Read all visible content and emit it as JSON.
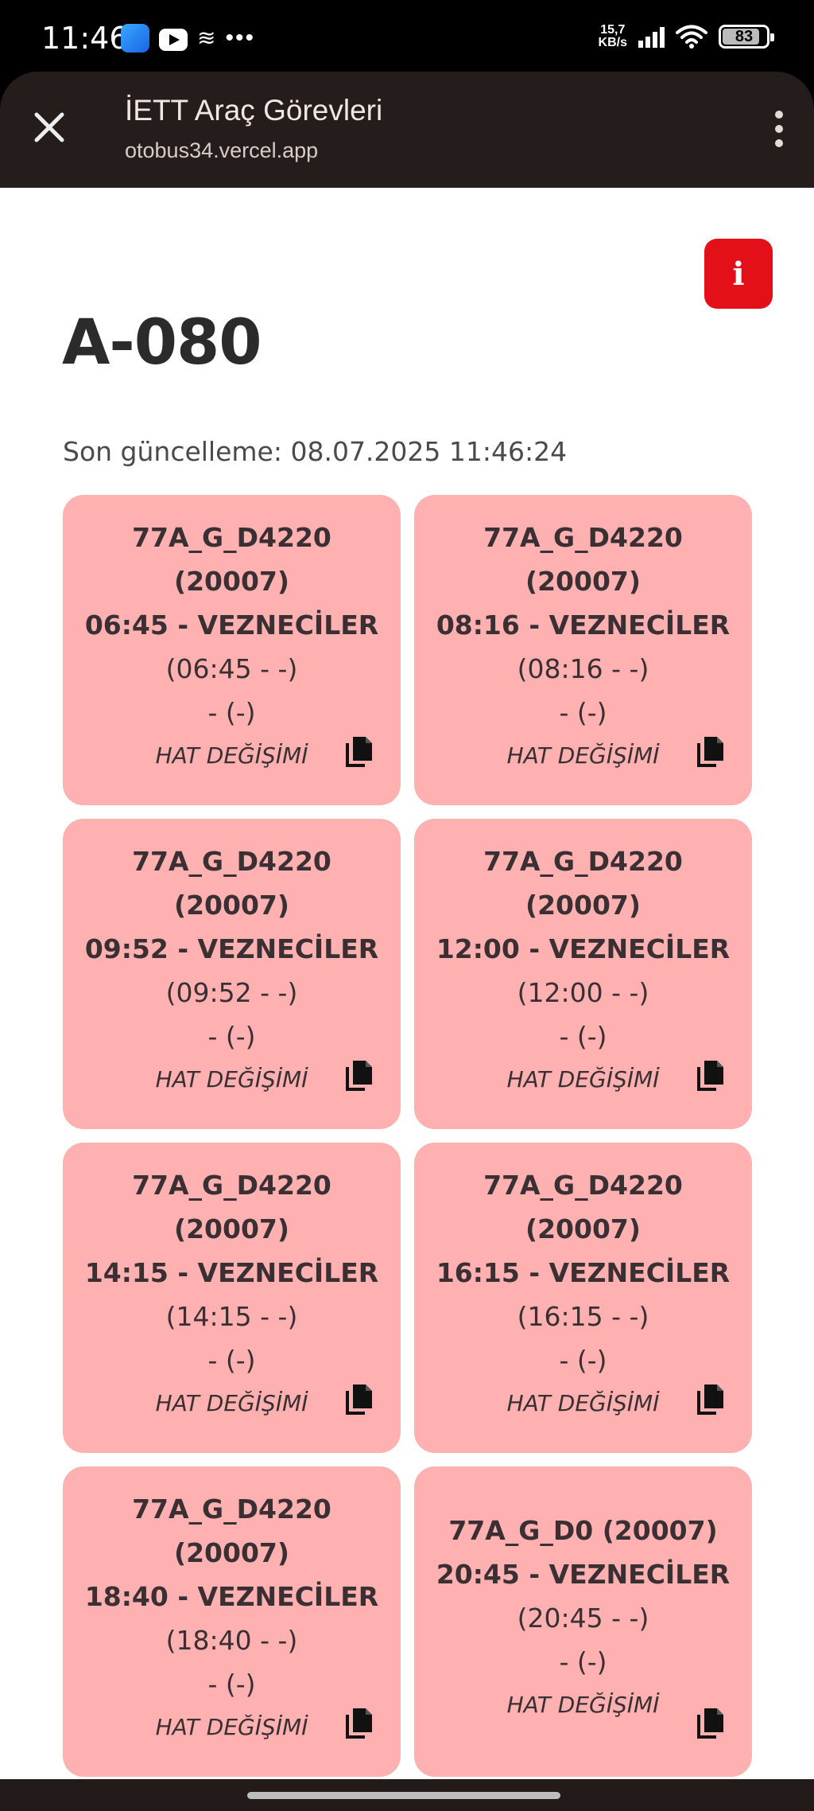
{
  "status_bar": {
    "time": "11:46",
    "net_speed_value": "15,7",
    "net_speed_unit": "KB/s",
    "battery": "83"
  },
  "toolbar": {
    "title": "İETT Araç Görevleri",
    "url": "otobus34.vercel.app"
  },
  "page": {
    "title": "A-080",
    "last_update": "Son güncelleme: 08.07.2025 11:46:24",
    "info_label": "i"
  },
  "cards": [
    {
      "line1": "77A_G_D4220",
      "line2": "(20007)",
      "line3": "06:45 - VEZNECİLER",
      "line4": "(06:45 - -)",
      "line5": "- (-)",
      "note": "HAT DEĞİŞİMİ"
    },
    {
      "line1": "77A_G_D4220",
      "line2": "(20007)",
      "line3": "08:16 - VEZNECİLER",
      "line4": "(08:16 - -)",
      "line5": "- (-)",
      "note": "HAT DEĞİŞİMİ"
    },
    {
      "line1": "77A_G_D4220",
      "line2": "(20007)",
      "line3": "09:52 - VEZNECİLER",
      "line4": "(09:52 - -)",
      "line5": "- (-)",
      "note": "HAT DEĞİŞİMİ"
    },
    {
      "line1": "77A_G_D4220",
      "line2": "(20007)",
      "line3": "12:00 - VEZNECİLER",
      "line4": "(12:00 - -)",
      "line5": "- (-)",
      "note": "HAT DEĞİŞİMİ"
    },
    {
      "line1": "77A_G_D4220",
      "line2": "(20007)",
      "line3": "14:15 - VEZNECİLER",
      "line4": "(14:15 - -)",
      "line5": "- (-)",
      "note": "HAT DEĞİŞİMİ"
    },
    {
      "line1": "77A_G_D4220",
      "line2": "(20007)",
      "line3": "16:15 - VEZNECİLER",
      "line4": "(16:15 - -)",
      "line5": "- (-)",
      "note": "HAT DEĞİŞİMİ"
    },
    {
      "line1": "77A_G_D4220",
      "line2": "(20007)",
      "line3": "18:40 - VEZNECİLER",
      "line4": "(18:40 - -)",
      "line5": "- (-)",
      "note": "HAT DEĞİŞİMİ"
    },
    {
      "line1": "77A_G_D0 (20007)",
      "line2": "",
      "line3": "20:45 - VEZNECİLER",
      "line4": "(20:45 - -)",
      "line5": "- (-)",
      "note": "HAT DEĞİŞİMİ"
    }
  ],
  "colors": {
    "card_bg": "#ffb0b0",
    "info_button": "#e3101a",
    "toolbar_bg": "#241d1c"
  }
}
